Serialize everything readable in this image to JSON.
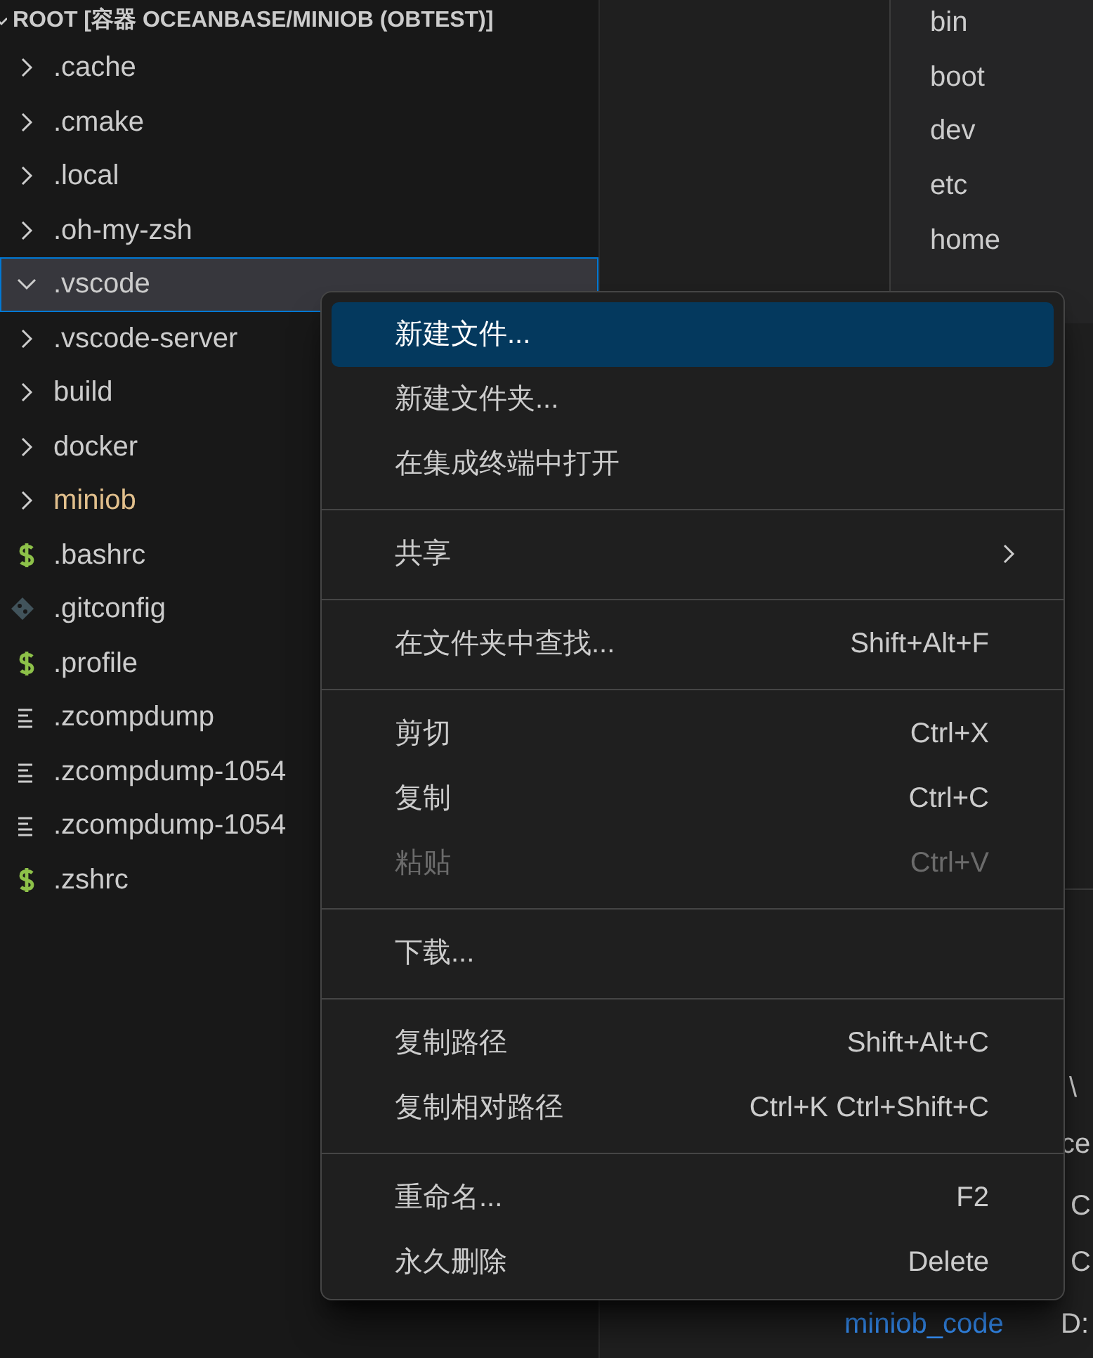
{
  "explorer": {
    "root_label": "ROOT [容器 OCEANBASE/MINIOB (OBTEST)]",
    "root_expanded": true,
    "items": [
      {
        "kind": "folder",
        "label": ".cache",
        "expanded": false,
        "selected": false
      },
      {
        "kind": "folder",
        "label": ".cmake",
        "expanded": false,
        "selected": false
      },
      {
        "kind": "folder",
        "label": ".local",
        "expanded": false,
        "selected": false
      },
      {
        "kind": "folder",
        "label": ".oh-my-zsh",
        "expanded": false,
        "selected": false
      },
      {
        "kind": "folder",
        "label": ".vscode",
        "expanded": true,
        "selected": true
      },
      {
        "kind": "folder",
        "label": ".vscode-server",
        "expanded": false,
        "selected": false
      },
      {
        "kind": "folder",
        "label": "build",
        "expanded": false,
        "selected": false
      },
      {
        "kind": "folder",
        "label": "docker",
        "expanded": false,
        "selected": false
      },
      {
        "kind": "folder",
        "label": "miniob",
        "expanded": false,
        "selected": false,
        "modified": true
      },
      {
        "kind": "shell",
        "label": ".bashrc",
        "selected": false
      },
      {
        "kind": "git",
        "label": ".gitconfig",
        "selected": false
      },
      {
        "kind": "shell",
        "label": ".profile",
        "selected": false
      },
      {
        "kind": "text",
        "label": ".zcompdump",
        "selected": false
      },
      {
        "kind": "text",
        "label": ".zcompdump-1054",
        "selected": false
      },
      {
        "kind": "text",
        "label": ".zcompdump-1054",
        "selected": false
      },
      {
        "kind": "shell",
        "label": ".zshrc",
        "selected": false
      }
    ]
  },
  "folder_list": [
    "bin",
    "boot",
    "dev",
    "etc",
    "home"
  ],
  "panel": {
    "fragments": [
      "\\",
      "ce",
      "C",
      "C"
    ],
    "link": "miniob_code",
    "path": "D:"
  },
  "context_menu": [
    {
      "kind": "item",
      "label": "新建文件...",
      "selected": true,
      "disabled": false
    },
    {
      "kind": "item",
      "label": "新建文件夹...",
      "selected": false,
      "disabled": false
    },
    {
      "kind": "item",
      "label": "在集成终端中打开",
      "selected": false,
      "disabled": false
    },
    {
      "kind": "separator"
    },
    {
      "kind": "submenu",
      "label": "共享",
      "selected": false,
      "disabled": false
    },
    {
      "kind": "separator"
    },
    {
      "kind": "item",
      "label": "在文件夹中查找...",
      "shortcut": "Shift+Alt+F",
      "selected": false,
      "disabled": false
    },
    {
      "kind": "separator"
    },
    {
      "kind": "item",
      "label": "剪切",
      "shortcut": "Ctrl+X",
      "selected": false,
      "disabled": false
    },
    {
      "kind": "item",
      "label": "复制",
      "shortcut": "Ctrl+C",
      "selected": false,
      "disabled": false
    },
    {
      "kind": "item",
      "label": "粘贴",
      "shortcut": "Ctrl+V",
      "selected": false,
      "disabled": true
    },
    {
      "kind": "separator"
    },
    {
      "kind": "item",
      "label": "下载...",
      "selected": false,
      "disabled": false
    },
    {
      "kind": "separator"
    },
    {
      "kind": "item",
      "label": "复制路径",
      "shortcut": "Shift+Alt+C",
      "selected": false,
      "disabled": false
    },
    {
      "kind": "item",
      "label": "复制相对路径",
      "shortcut": "Ctrl+K Ctrl+Shift+C",
      "selected": false,
      "disabled": false
    },
    {
      "kind": "separator"
    },
    {
      "kind": "item",
      "label": "重命名...",
      "shortcut": "F2",
      "selected": false,
      "disabled": false
    },
    {
      "kind": "item",
      "label": "永久删除",
      "shortcut": "Delete",
      "selected": false,
      "disabled": false
    }
  ]
}
